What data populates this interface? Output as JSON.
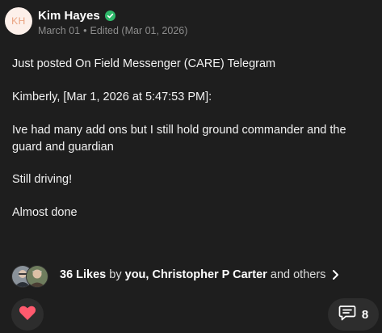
{
  "post": {
    "avatar_initials": "KH",
    "author": "Kim Hayes",
    "date": "March 01",
    "separator": "•",
    "edited": "Edited (Mar 01, 2026)",
    "paragraphs": [
      "Just posted On Field Messenger (CARE) Telegram",
      "Kimberly, [Mar 1, 2026 at 5:47:53 PM]:",
      "Ive had many add ons but I still hold ground commander and the guard and guardian",
      "Still driving!",
      "Almost done"
    ]
  },
  "likes": {
    "count_label": "36 Likes",
    "by_word": "by",
    "names": "you, Christopher P Carter",
    "others": "and others"
  },
  "actions": {
    "comment_count": "8"
  },
  "colors": {
    "background": "#1e1e1e",
    "verified": "#2fb86a",
    "heart": "#ff5a6e"
  }
}
